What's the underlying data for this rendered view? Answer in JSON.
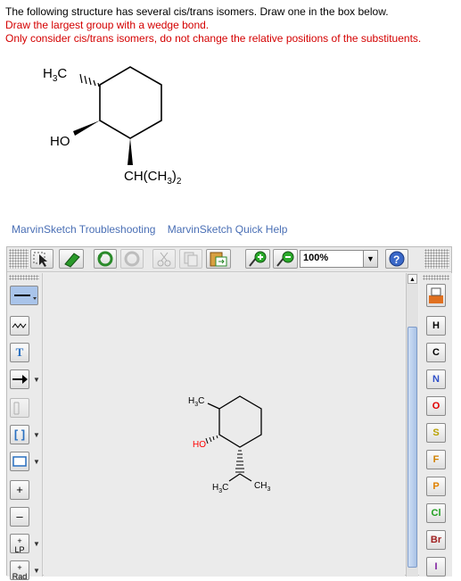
{
  "question": {
    "line1": "The following structure has several cis/trans isomers. Draw one in the box below.",
    "line2": "Draw the largest group with a wedge bond.",
    "line3": "Only consider cis/trans isomers, do not change the relative positions of the substituents."
  },
  "structure_labels": {
    "methyl_prefix": "H",
    "methyl_sub": "3",
    "methyl_suffix": "C",
    "hydroxyl": "HO",
    "isopropyl_a": "CH(CH",
    "isopropyl_sub1": "3",
    "isopropyl_b": ")",
    "isopropyl_sub2": "2"
  },
  "links": {
    "troubleshooting": "MarvinSketch Troubleshooting",
    "quick_help": "MarvinSketch Quick Help"
  },
  "toolbar": {
    "zoom": "100%",
    "help_icon": "?"
  },
  "canvas_labels": {
    "h3c_top": "H",
    "h3c_top_sub": "3",
    "h3c_top_c": "C",
    "ho": "HO",
    "h3c_bottom": "H",
    "h3c_bottom_sub": "3",
    "h3c_bottom_c": "C",
    "ch3": "CH",
    "ch3_sub": "3"
  },
  "left_tools": {
    "text_tool": "T",
    "plus": "+",
    "minus": "–",
    "lp": "LP",
    "rad": "Rad"
  },
  "elements": [
    "H",
    "C",
    "N",
    "O",
    "S",
    "F",
    "P",
    "Cl",
    "Br",
    "I"
  ],
  "colors": {
    "question_red": "#d40000",
    "link_blue": "#4a6fb5",
    "hetero_red": "#ff0000",
    "N": "#3050c8",
    "O": "#e00000",
    "S": "#b8a000",
    "F": "#d08000",
    "P": "#e08000",
    "Cl": "#20a020",
    "Br": "#a02020",
    "I": "#8020a0"
  }
}
